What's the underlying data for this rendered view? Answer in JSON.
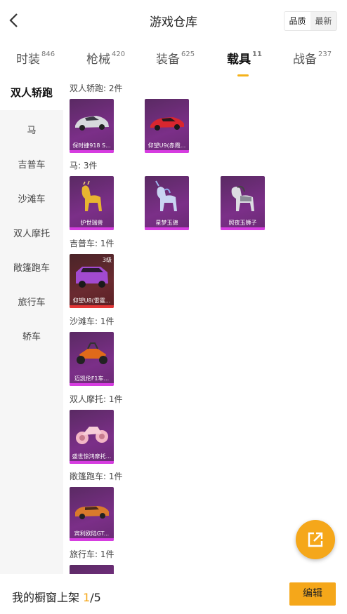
{
  "header": {
    "title": "游戏仓库",
    "sort_quality": "品质",
    "sort_newest": "最新"
  },
  "tabs": [
    {
      "label": "时装",
      "count": "846"
    },
    {
      "label": "枪械",
      "count": "420"
    },
    {
      "label": "装备",
      "count": "625"
    },
    {
      "label": "载具",
      "count": "11"
    },
    {
      "label": "战备",
      "count": "237"
    }
  ],
  "sidebar": [
    "双人轿跑",
    "马",
    "吉普车",
    "沙滩车",
    "双人摩托",
    "敞篷跑车",
    "旅行车",
    "轿车"
  ],
  "categories": [
    {
      "label": "双人轿跑: 2件",
      "items": [
        {
          "name": "保时捷918 S..."
        },
        {
          "name": "仰望U9(赤霞..."
        }
      ]
    },
    {
      "label": "马: 3件",
      "items": [
        {
          "name": "护世瑞兽"
        },
        {
          "name": "星梦玉骢"
        },
        {
          "name": "照夜玉狮子"
        }
      ]
    },
    {
      "label": "吉普车: 1件",
      "items": [
        {
          "name": "仰望U8(雷霆...",
          "level": "3级"
        }
      ]
    },
    {
      "label": "沙滩车: 1件",
      "items": [
        {
          "name": "迈凯伦F1车..."
        }
      ]
    },
    {
      "label": "双人摩托: 1件",
      "items": [
        {
          "name": "盛世惊鸿摩托..."
        }
      ]
    },
    {
      "label": "敞篷跑车: 1件",
      "items": [
        {
          "name": "宾利欧陆GT..."
        }
      ]
    },
    {
      "label": "旅行车: 1件",
      "items": []
    }
  ],
  "footer": {
    "prefix": "我的橱窗上架 ",
    "current": "1",
    "total": "/5",
    "edit_label": "编辑"
  },
  "colors": {
    "accent": "#f5a71a",
    "card_purple": "#7b2f88",
    "card_red": "#6a2a30"
  }
}
